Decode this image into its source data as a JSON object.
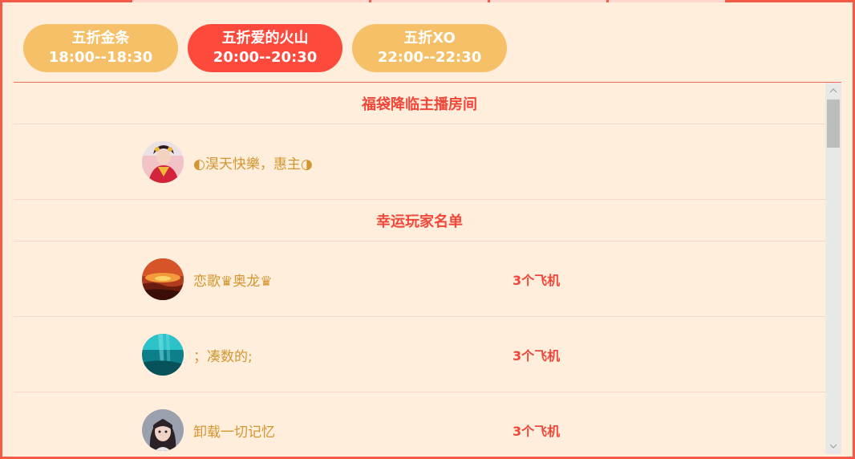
{
  "tabs": [
    {
      "title": "五折金条",
      "time": "18:00--18:30",
      "active": false
    },
    {
      "title": "五折爱的火山",
      "time": "20:00--20:30",
      "active": true
    },
    {
      "title": "五折XO",
      "time": "22:00--22:30",
      "active": false
    }
  ],
  "host_section": {
    "title": "福袋降临主播房间",
    "host": {
      "name": "◐淏天快樂，惠主◑",
      "avatar": "host-avatar"
    }
  },
  "winners_section": {
    "title": "幸运玩家名单",
    "winners": [
      {
        "name": "恋歌♛奥龙♛",
        "prize": "3个飞机",
        "avatar": "sunset-avatar"
      },
      {
        "name": "；凑数的;",
        "prize": "3个飞机",
        "avatar": "ocean-avatar"
      },
      {
        "name": "卸载一切记忆",
        "prize": "3个飞机",
        "avatar": "girl-avatar"
      }
    ]
  },
  "colors": {
    "border": "#f35b47",
    "background": "#ffeedb",
    "tab_inactive": "#f5c068",
    "tab_active": "#fe4a3c",
    "accent_text": "#f1473a",
    "name_text": "#d39530"
  },
  "icons": {
    "scroll_up": "chevron-up-icon",
    "scroll_down": "chevron-down-icon"
  }
}
